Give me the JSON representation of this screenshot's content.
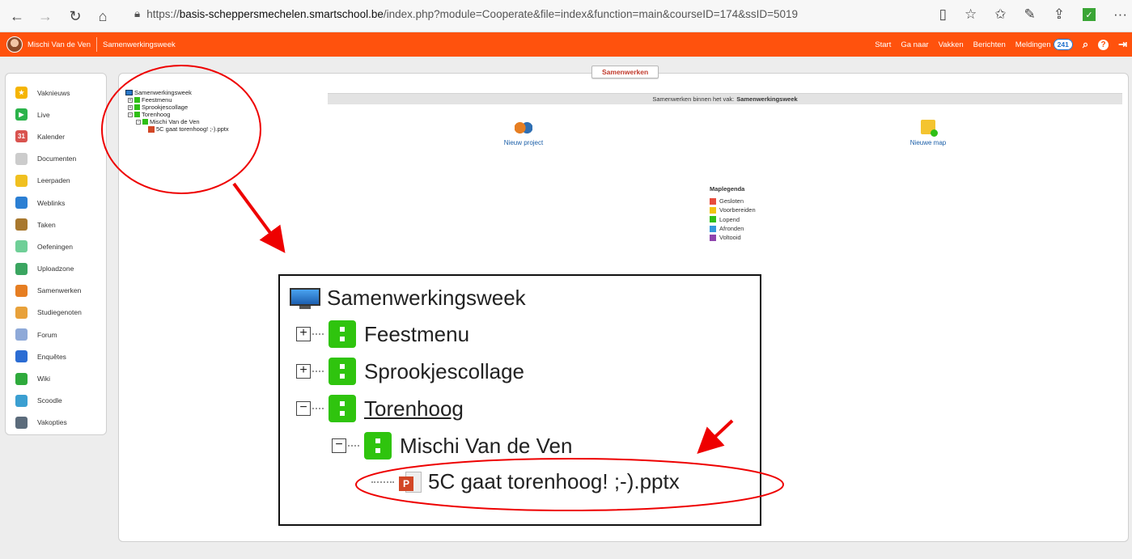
{
  "browser": {
    "url_prefix": "https://",
    "url_host": "basis-scheppersmechelen.smartschool.be",
    "url_path": "/index.php?module=Cooperate&file=index&function=main&courseID=174&ssID=5019"
  },
  "topbar": {
    "user_name": "Mischi Van de Ven",
    "course_name": "Samenwerkingsweek",
    "nav": [
      "Start",
      "Ga naar",
      "Vakken",
      "Berichten"
    ],
    "notifications_label": "Meldingen",
    "notifications_count": "241",
    "accent": "#ff520d"
  },
  "sidebar": {
    "items": [
      {
        "label": "Vaknieuws",
        "icon": "star-icon",
        "color": "#f5b400",
        "glyph": "★"
      },
      {
        "label": "Live",
        "icon": "video-icon",
        "color": "#2bb34a",
        "glyph": "▶"
      },
      {
        "label": "Kalender",
        "icon": "calendar-icon",
        "color": "#d9534f",
        "glyph": "31"
      },
      {
        "label": "Documenten",
        "icon": "document-icon",
        "color": "#cccccc",
        "glyph": ""
      },
      {
        "label": "Leerpaden",
        "icon": "footsteps-icon",
        "color": "#f0c020",
        "glyph": ""
      },
      {
        "label": "Weblinks",
        "icon": "globe-icon",
        "color": "#2b7fd3",
        "glyph": ""
      },
      {
        "label": "Taken",
        "icon": "task-icon",
        "color": "#a8782e",
        "glyph": ""
      },
      {
        "label": "Oefeningen",
        "icon": "exercise-icon",
        "color": "#6fcf97",
        "glyph": ""
      },
      {
        "label": "Uploadzone",
        "icon": "upload-icon",
        "color": "#3aa560",
        "glyph": ""
      },
      {
        "label": "Samenwerken",
        "icon": "handshake-icon",
        "color": "#e67e22",
        "glyph": ""
      },
      {
        "label": "Studiegenoten",
        "icon": "people-icon",
        "color": "#e8a13a",
        "glyph": ""
      },
      {
        "label": "Forum",
        "icon": "forum-icon",
        "color": "#8ea9d8",
        "glyph": ""
      },
      {
        "label": "Enquêtes",
        "icon": "pie-chart-icon",
        "color": "#2b6cd3",
        "glyph": ""
      },
      {
        "label": "Wiki",
        "icon": "pencil-icon",
        "color": "#2eaa3c",
        "glyph": ""
      },
      {
        "label": "Scoodle",
        "icon": "scoodle-icon",
        "color": "#3b9fd1",
        "glyph": ""
      },
      {
        "label": "Vakopties",
        "icon": "wrench-icon",
        "color": "#5b6b7b",
        "glyph": ""
      }
    ]
  },
  "main": {
    "tab_label": "Samenwerken",
    "info_prefix": "Samenwerken binnen het vak:",
    "info_course": "Samenwerkingsweek",
    "new_project_label": "Nieuw project",
    "new_folder_label": "Nieuwe map"
  },
  "tree": {
    "root": "Samenwerkingsweek",
    "nodes": [
      {
        "label": "Feestmenu",
        "toggle": "+"
      },
      {
        "label": "Sprookjescollage",
        "toggle": "+"
      },
      {
        "label": "Torenhoog",
        "toggle": "−"
      }
    ],
    "child": "Mischi Van de Ven",
    "file": "5C gaat torenhoog! ;-).pptx"
  },
  "legend": {
    "title": "Maplegenda",
    "items": [
      {
        "label": "Gesloten",
        "color": "#e74c3c"
      },
      {
        "label": "Voorbereiden",
        "color": "#f1c40f"
      },
      {
        "label": "Lopend",
        "color": "#2fbf16"
      },
      {
        "label": "Afronden",
        "color": "#3498db"
      },
      {
        "label": "Voltooid",
        "color": "#8e44ad"
      }
    ]
  }
}
